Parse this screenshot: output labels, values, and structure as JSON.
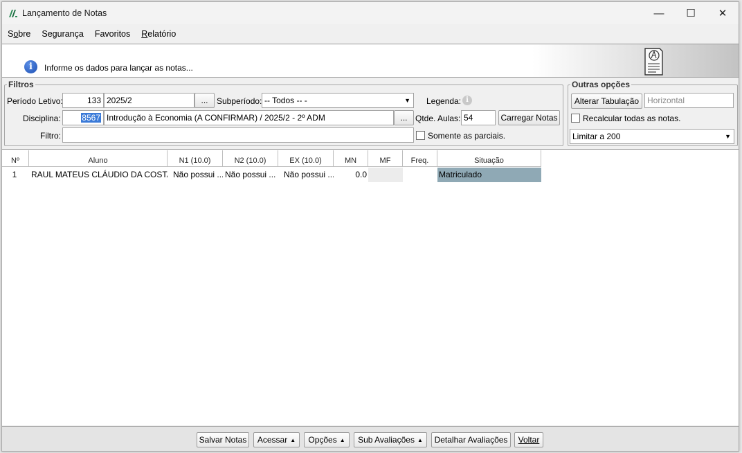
{
  "window": {
    "title": "Lançamento de Notas",
    "controls": {
      "minimize": "—",
      "maximize": "☐",
      "close": "✕"
    }
  },
  "menu": [
    {
      "label": "Sobre",
      "underline": "o"
    },
    {
      "label": "Segurança"
    },
    {
      "label": "Favoritos"
    },
    {
      "label": "Relatório",
      "underline": "R"
    }
  ],
  "info": {
    "message": "Informe os dados para lançar as notas..."
  },
  "filtros": {
    "legend": "Filtros",
    "periodo_label": "Período Letivo:",
    "periodo_code": "133",
    "periodo_name": "2025/2",
    "browse_label": "...",
    "subperiodo_label": "Subperíodo:",
    "subperiodo_value": "-- Todos -- -",
    "legenda_label": "Legenda:",
    "disciplina_label": "Disciplina:",
    "disciplina_code": "8567",
    "disciplina_name": "Introdução à Economia (A CONFIRMAR) / 2025/2 - 2º ADM",
    "qtde_label": "Qtde. Aulas:",
    "qtde_value": "54",
    "carregar_label": "Carregar Notas",
    "filtro_label": "Filtro:",
    "filtro_value": "",
    "somente_label": "Somente as parciais.",
    "somente_checked": false
  },
  "outras": {
    "legend": "Outras opções",
    "alterar_label": "Alterar Tabulação",
    "tabulacao_value": "Horizontal",
    "recalcular_label": "Recalcular todas as notas.",
    "recalcular_checked": false,
    "limitar_value": "Limitar a 200"
  },
  "grid": {
    "columns": [
      "Nº",
      "Aluno",
      "N1 (10.0)",
      "N2 (10.0)",
      "EX (10.0)",
      "MN",
      "MF",
      "Freq.",
      "Situação"
    ],
    "rows": [
      {
        "n": "1",
        "aluno": "RAUL MATEUS CLÁUDIO DA COSTA",
        "n1": "Não possui ...",
        "n2": "Não possui ...",
        "ex": "Não possui ...",
        "mn": "0.0",
        "mf": "",
        "freq": "",
        "situacao": "Matriculado"
      }
    ]
  },
  "colors": {
    "situacao_bg": "#8fa9b5",
    "mf_bg": "#ececec",
    "accent": "#1c4fb3"
  },
  "footer": {
    "salvar": "Salvar Notas",
    "acessar": "Acessar",
    "opcoes": "Opções",
    "sub_avaliacoes": "Sub Avaliações",
    "detalhar": "Detalhar Avaliações",
    "voltar": "Voltar"
  }
}
